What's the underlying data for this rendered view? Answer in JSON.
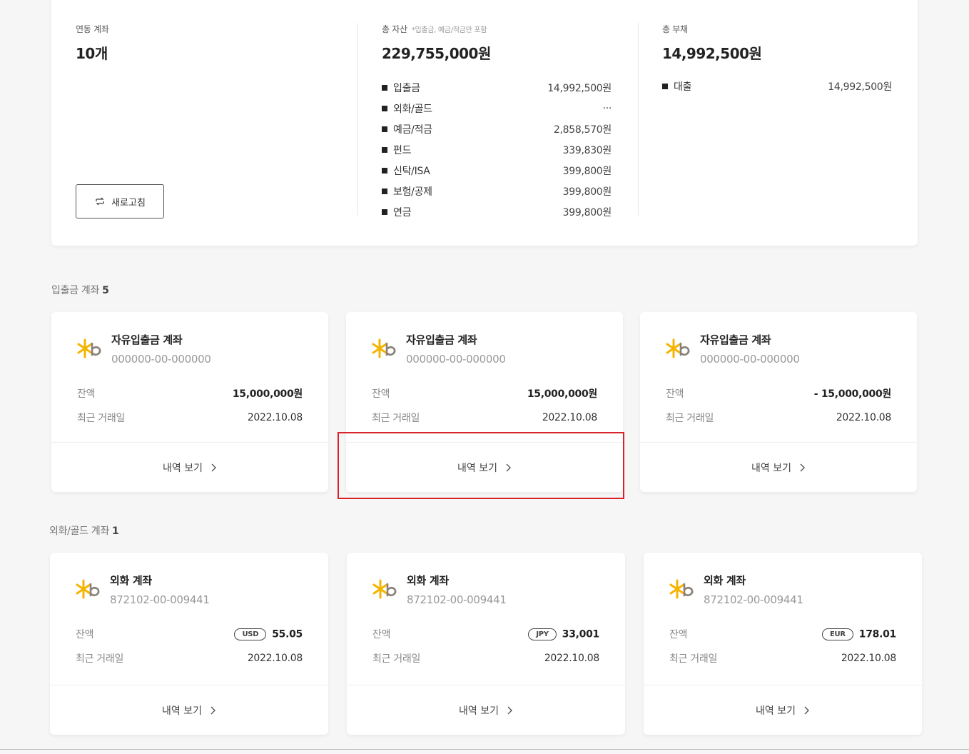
{
  "summary": {
    "linked_accounts": {
      "label": "연동 계좌",
      "value": "10개"
    },
    "refresh_label": "새로고침",
    "total_assets": {
      "label": "총 자산",
      "note": "*입출금, 예금/적금만 포함",
      "value": "229,755,000원",
      "items": [
        {
          "label": "입출금",
          "amount": "14,992,500원"
        },
        {
          "label": "외화/골드",
          "amount": "···"
        },
        {
          "label": "예금/적금",
          "amount": "2,858,570원"
        },
        {
          "label": "펀드",
          "amount": "339,830원"
        },
        {
          "label": "신탁/ISA",
          "amount": "399,800원"
        },
        {
          "label": "보험/공제",
          "amount": "399,800원"
        },
        {
          "label": "연금",
          "amount": "399,800원"
        }
      ]
    },
    "total_liabilities": {
      "label": "총 부채",
      "value": "14,992,500원",
      "items": [
        {
          "label": "대출",
          "amount": "14,992,500원"
        }
      ]
    }
  },
  "deposit_section": {
    "title": "입출금 계좌",
    "count": "5",
    "accounts": [
      {
        "name": "자유입출금 계좌",
        "number": "000000-00-000000",
        "balance_label": "잔액",
        "balance": "15,000,000원",
        "date_label": "최근 거래일",
        "date": "2022.10.08",
        "link": "내역 보기"
      },
      {
        "name": "자유입출금 계좌",
        "number": "000000-00-000000",
        "balance_label": "잔액",
        "balance": "15,000,000원",
        "date_label": "최근 거래일",
        "date": "2022.10.08",
        "link": "내역 보기"
      },
      {
        "name": "자유입출금 계좌",
        "number": "000000-00-000000",
        "balance_label": "잔액",
        "balance": "- 15,000,000원",
        "date_label": "최근 거래일",
        "date": "2022.10.08",
        "link": "내역 보기"
      }
    ]
  },
  "fx_section": {
    "title": "외화/골드 계좌",
    "count": "1",
    "accounts": [
      {
        "name": "외화 계좌",
        "number": "872102-00-009441",
        "balance_label": "잔액",
        "currency": "USD",
        "balance": "55.05",
        "date_label": "최근 거래일",
        "date": "2022.10.08",
        "link": "내역 보기"
      },
      {
        "name": "외화 계좌",
        "number": "872102-00-009441",
        "balance_label": "잔액",
        "currency": "JPY",
        "balance": "33,001",
        "date_label": "최근 거래일",
        "date": "2022.10.08",
        "link": "내역 보기"
      },
      {
        "name": "외화 계좌",
        "number": "872102-00-009441",
        "balance_label": "잔액",
        "currency": "EUR",
        "balance": "178.01",
        "date_label": "최근 거래일",
        "date": "2022.10.08",
        "link": "내역 보기"
      }
    ]
  },
  "colors": {
    "kb_yellow": "#f5b400",
    "kb_gray": "#8a8178",
    "highlight_red": "#d8232a"
  }
}
